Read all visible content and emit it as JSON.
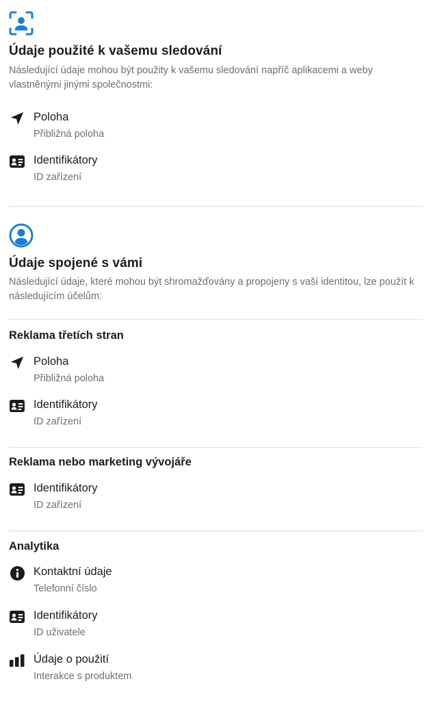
{
  "tracking": {
    "title": "Údaje použité k vašemu sledování",
    "description": "Následující údaje mohou být použity k vašemu sledování napříč aplikacemi a weby vlastněnými jinými společnostmi:",
    "icon": "face-scan-icon",
    "items": [
      {
        "icon": "location-arrow-icon",
        "label": "Poloha",
        "detail": "Přibližná poloha"
      },
      {
        "icon": "id-card-icon",
        "label": "Identifikátory",
        "detail": "ID zařízení"
      }
    ]
  },
  "linked": {
    "title": "Údaje spojené s vámi",
    "description": "Následující údaje, které mohou být shromažďovány a propojeny s vaší identitou, lze použít k následujícím účelům:",
    "icon": "person-circle-icon",
    "groups": [
      {
        "heading": "Reklama třetích stran",
        "items": [
          {
            "icon": "location-arrow-icon",
            "label": "Poloha",
            "detail": "Přibližná poloha"
          },
          {
            "icon": "id-card-icon",
            "label": "Identifikátory",
            "detail": "ID zařízení"
          }
        ]
      },
      {
        "heading": "Reklama nebo marketing vývojáře",
        "items": [
          {
            "icon": "id-card-icon",
            "label": "Identifikátory",
            "detail": "ID zařízení"
          }
        ]
      },
      {
        "heading": "Analytika",
        "items": [
          {
            "icon": "info-circle-icon",
            "label": "Kontaktní údaje",
            "detail": "Telefonní číslo"
          },
          {
            "icon": "id-card-icon",
            "label": "Identifikátory",
            "detail": "ID uživatele"
          },
          {
            "icon": "bar-chart-icon",
            "label": "Údaje o použití",
            "detail": "Interakce s produktem"
          }
        ]
      }
    ]
  },
  "colors": {
    "accent": "#1a7fd4",
    "text": "#1c1c1e",
    "secondary": "#6e6e73",
    "divider": "#dedee2"
  }
}
